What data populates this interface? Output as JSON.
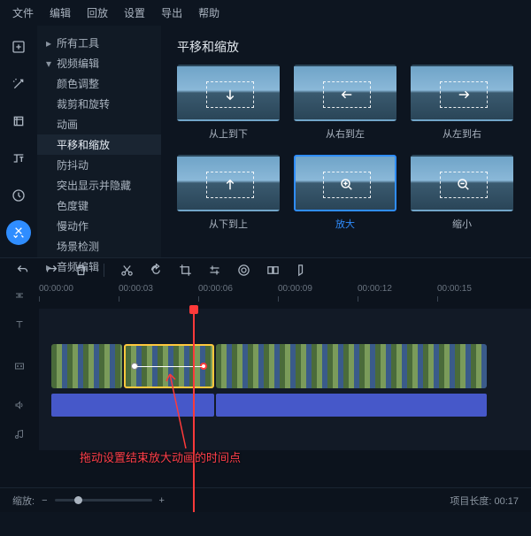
{
  "menu": {
    "items": [
      "文件",
      "编辑",
      "回放",
      "设置",
      "导出",
      "帮助"
    ]
  },
  "rail": {
    "icons": [
      "add-icon",
      "wand-icon",
      "crop-icon",
      "text-icon",
      "clock-icon",
      "tools-icon"
    ],
    "active": 5
  },
  "tree": {
    "items": [
      {
        "label": "所有工具",
        "expand": true,
        "open": false
      },
      {
        "label": "视频编辑",
        "expand": true,
        "open": true
      },
      {
        "label": "颜色调整"
      },
      {
        "label": "裁剪和旋转"
      },
      {
        "label": "动画"
      },
      {
        "label": "平移和缩放",
        "selected": true
      },
      {
        "label": "防抖动"
      },
      {
        "label": "突出显示并隐藏"
      },
      {
        "label": "色度键"
      },
      {
        "label": "慢动作"
      },
      {
        "label": "场景检测"
      },
      {
        "label": "音频编辑",
        "expand": true,
        "open": false
      }
    ]
  },
  "effects": {
    "title": "平移和缩放",
    "items": [
      {
        "label": "从上到下",
        "icon": "down"
      },
      {
        "label": "从右到左",
        "icon": "left"
      },
      {
        "label": "从左到右",
        "icon": "right"
      },
      {
        "label": "从下到上",
        "icon": "up"
      },
      {
        "label": "放大",
        "icon": "zoomin",
        "selected": true
      },
      {
        "label": "缩小",
        "icon": "zoomout"
      }
    ]
  },
  "ruler": [
    "00:00:00",
    "00:00:03",
    "00:00:06",
    "00:00:09",
    "00:00:12",
    "00:00:15"
  ],
  "annotation": "拖动设置结束放大动画的时间点",
  "footer": {
    "zoom_label": "缩放:",
    "duration_label": "项目长度:",
    "duration": "00:17"
  }
}
